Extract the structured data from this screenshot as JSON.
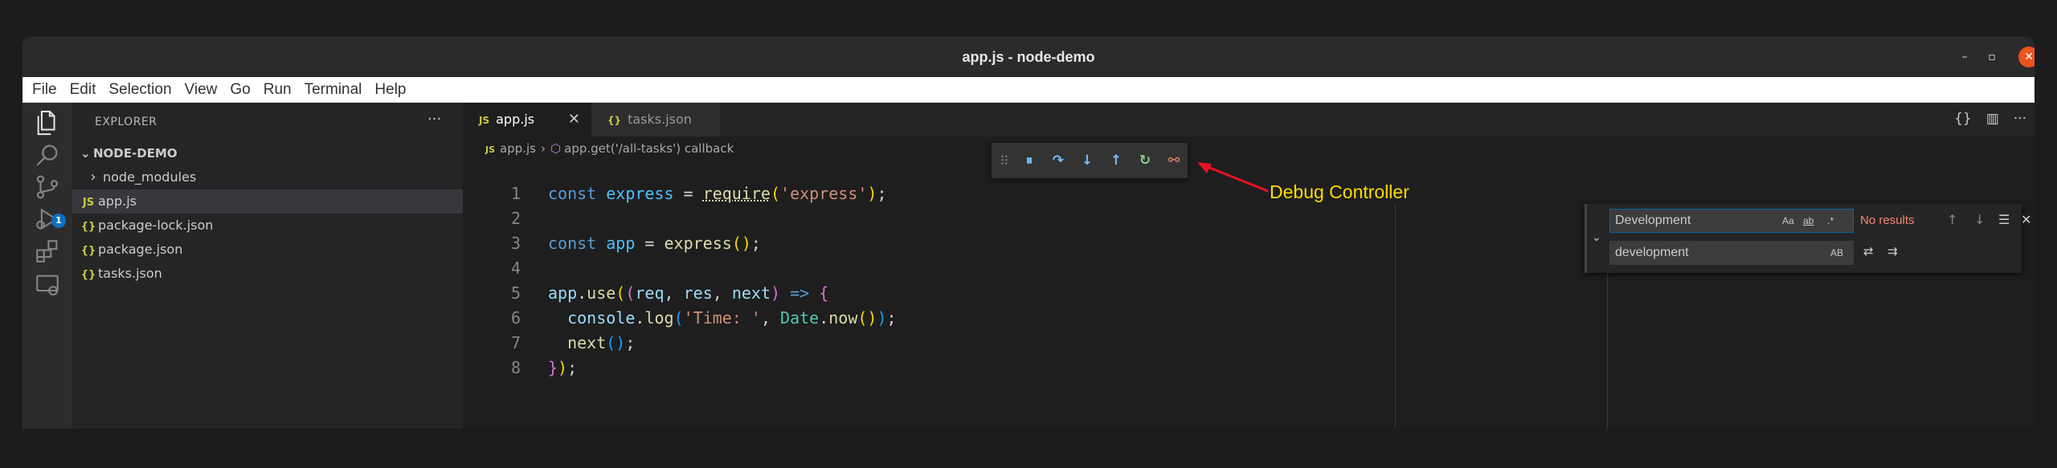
{
  "window": {
    "title": "app.js - node-demo",
    "min": "–",
    "max": "▫",
    "close": "✕"
  },
  "menu": [
    "File",
    "Edit",
    "Selection",
    "View",
    "Go",
    "Run",
    "Terminal",
    "Help"
  ],
  "activity": {
    "icons": [
      "files-icon",
      "search-icon",
      "source-control-icon",
      "run-debug-icon",
      "extensions-icon",
      "remote-explorer-icon"
    ],
    "debug_badge": "1"
  },
  "explorer": {
    "header": "EXPLORER",
    "more": "···",
    "section": "NODE-DEMO",
    "items": [
      {
        "label": "node_modules",
        "icon": "›",
        "kind": "folder"
      },
      {
        "label": "app.js",
        "icon": "JS",
        "kind": "js",
        "selected": true
      },
      {
        "label": "package-lock.json",
        "icon": "{}",
        "kind": "json"
      },
      {
        "label": "package.json",
        "icon": "{}",
        "kind": "json"
      },
      {
        "label": "tasks.json",
        "icon": "{}",
        "kind": "json"
      }
    ]
  },
  "tabs": [
    {
      "label": "app.js",
      "icon": "JS",
      "active": true,
      "close": "✕"
    },
    {
      "label": "tasks.json",
      "icon": "{}",
      "active": false
    }
  ],
  "tab_actions": [
    "{}",
    "▥",
    "···"
  ],
  "breadcrumb": {
    "file_icon": "JS",
    "file": "app.js",
    "sep": "›",
    "symbol": "app.get('/all-tasks') callback"
  },
  "debug_toolbar": {
    "buttons": [
      {
        "name": "pause-icon",
        "glyph": "⏸",
        "color": "#75beff"
      },
      {
        "name": "step-over-icon",
        "glyph": "↷",
        "color": "#75beff"
      },
      {
        "name": "step-into-icon",
        "glyph": "↓",
        "color": "#75beff"
      },
      {
        "name": "step-out-icon",
        "glyph": "↑",
        "color": "#75beff"
      },
      {
        "name": "restart-icon",
        "glyph": "↻",
        "color": "#89d185"
      },
      {
        "name": "disconnect-icon",
        "glyph": "⚯",
        "color": "#f48771"
      }
    ]
  },
  "annotation": {
    "label": "Debug Controller",
    "color": "#ffdb00"
  },
  "code": {
    "line_numbers": [
      "1",
      "2",
      "3",
      "4",
      "5",
      "6",
      "7",
      "8"
    ]
  },
  "find_widget": {
    "find_value": "Development",
    "replace_value": "development",
    "find_options": [
      "Aa",
      "ab",
      ".*"
    ],
    "replace_option": "AB",
    "status": "No results",
    "actions": [
      "↑",
      "↓",
      "☰",
      "✕"
    ],
    "replace_actions": [
      "⇄",
      "⇉"
    ],
    "toggle": "⌄"
  }
}
